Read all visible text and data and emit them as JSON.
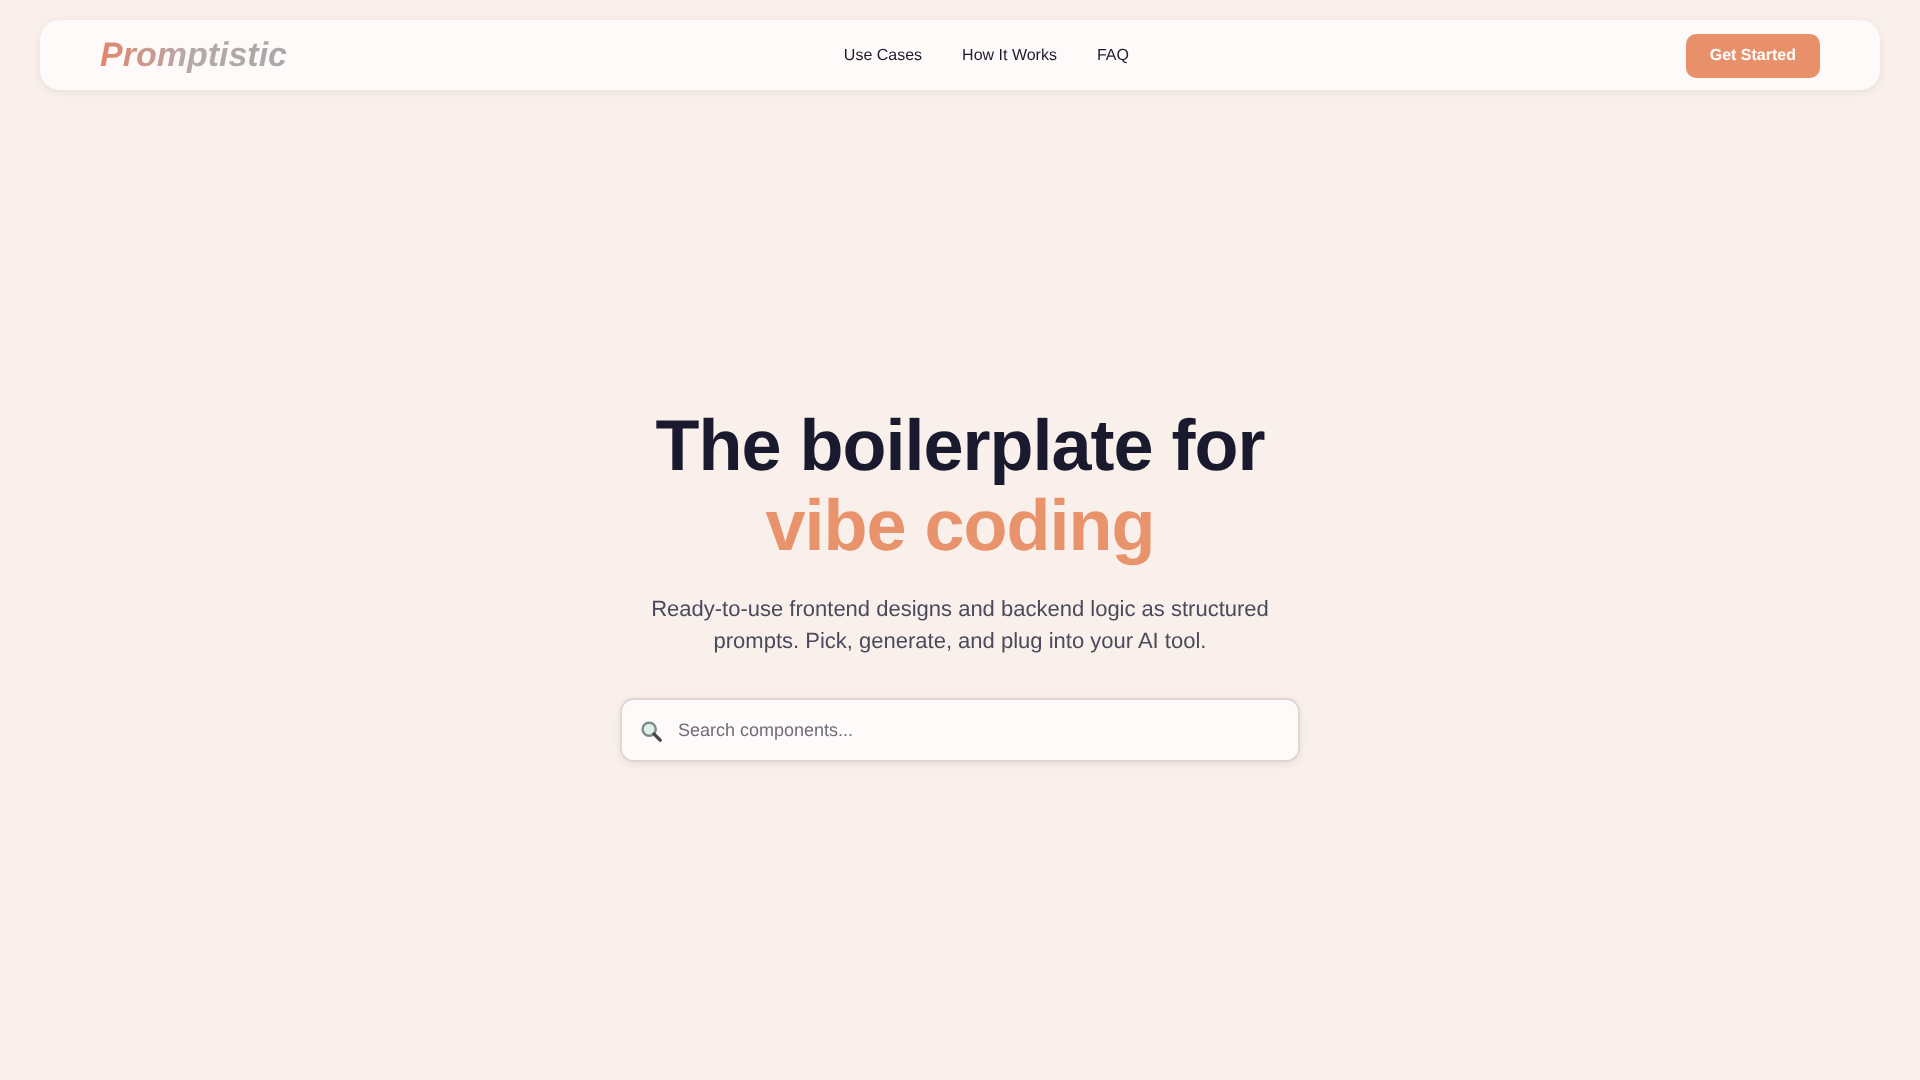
{
  "navbar": {
    "logo": "Promptistic",
    "links": [
      {
        "label": "Use Cases"
      },
      {
        "label": "How It Works"
      },
      {
        "label": "FAQ"
      }
    ],
    "cta": "Get Started"
  },
  "hero": {
    "title_line_1": "The boilerplate for",
    "title_line_2": "vibe coding",
    "subtitle": "Ready-to-use frontend designs and backend logic as structured prompts. Pick, generate, and plug into your AI tool.",
    "search": {
      "placeholder": "Search components..."
    }
  }
}
